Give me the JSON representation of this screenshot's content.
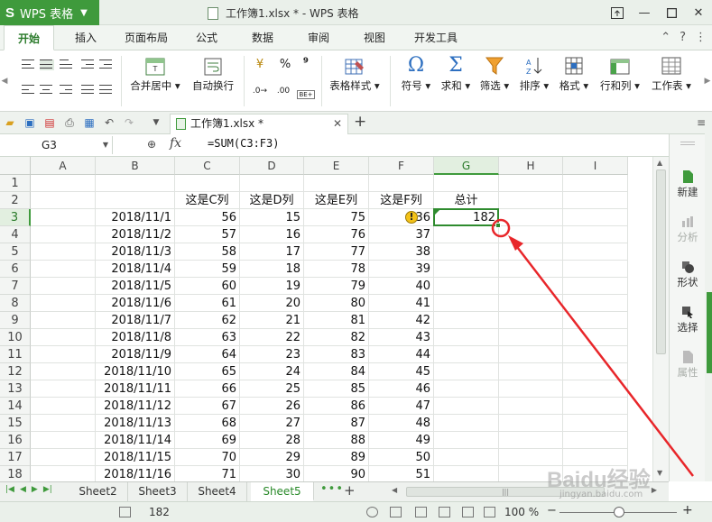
{
  "titlebar": {
    "app_name": "WPS 表格",
    "window_title": "工作簿1.xlsx * - WPS 表格"
  },
  "menu": {
    "tabs": [
      "开始",
      "插入",
      "页面布局",
      "公式",
      "数据",
      "审阅",
      "视图",
      "开发工具"
    ],
    "active_tab": "开始"
  },
  "ribbon": {
    "merge_center": "合并居中",
    "auto_wrap": "自动换行",
    "percent": "%",
    "comma": "⁹",
    "table_style": "表格样式",
    "symbol": "符号",
    "sum": "求和",
    "filter": "筛选",
    "sort": "排序",
    "format": "格式",
    "row_col": "行和列",
    "worksheet": "工作表"
  },
  "doc_tab": {
    "title": "工作簿1.xlsx *"
  },
  "formula_bar": {
    "cell_ref": "G3",
    "fx": "fx",
    "formula": "=SUM(C3:F3)"
  },
  "grid": {
    "columns": [
      "A",
      "B",
      "C",
      "D",
      "E",
      "F",
      "G",
      "H",
      "I"
    ],
    "row_numbers": [
      "1",
      "2",
      "3",
      "4",
      "5",
      "6",
      "7",
      "8",
      "9",
      "10",
      "11",
      "12",
      "13",
      "14",
      "15",
      "16",
      "17",
      "18"
    ],
    "headers_row2": {
      "C": "这是C列",
      "D": "这是D列",
      "E": "这是E列",
      "F": "这是F列",
      "G": "总计"
    },
    "rows": [
      {
        "date": "2018/11/1",
        "c": "56",
        "d": "15",
        "e": "75",
        "f": "36",
        "g": "182"
      },
      {
        "date": "2018/11/2",
        "c": "57",
        "d": "16",
        "e": "76",
        "f": "37",
        "g": ""
      },
      {
        "date": "2018/11/3",
        "c": "58",
        "d": "17",
        "e": "77",
        "f": "38",
        "g": ""
      },
      {
        "date": "2018/11/4",
        "c": "59",
        "d": "18",
        "e": "78",
        "f": "39",
        "g": ""
      },
      {
        "date": "2018/11/5",
        "c": "60",
        "d": "19",
        "e": "79",
        "f": "40",
        "g": ""
      },
      {
        "date": "2018/11/6",
        "c": "61",
        "d": "20",
        "e": "80",
        "f": "41",
        "g": ""
      },
      {
        "date": "2018/11/7",
        "c": "62",
        "d": "21",
        "e": "81",
        "f": "42",
        "g": ""
      },
      {
        "date": "2018/11/8",
        "c": "63",
        "d": "22",
        "e": "82",
        "f": "43",
        "g": ""
      },
      {
        "date": "2018/11/9",
        "c": "64",
        "d": "23",
        "e": "83",
        "f": "44",
        "g": ""
      },
      {
        "date": "2018/11/10",
        "c": "65",
        "d": "24",
        "e": "84",
        "f": "45",
        "g": ""
      },
      {
        "date": "2018/11/11",
        "c": "66",
        "d": "25",
        "e": "85",
        "f": "46",
        "g": ""
      },
      {
        "date": "2018/11/12",
        "c": "67",
        "d": "26",
        "e": "86",
        "f": "47",
        "g": ""
      },
      {
        "date": "2018/11/13",
        "c": "68",
        "d": "27",
        "e": "87",
        "f": "48",
        "g": ""
      },
      {
        "date": "2018/11/14",
        "c": "69",
        "d": "28",
        "e": "88",
        "f": "49",
        "g": ""
      },
      {
        "date": "2018/11/15",
        "c": "70",
        "d": "29",
        "e": "89",
        "f": "50",
        "g": ""
      },
      {
        "date": "2018/11/16",
        "c": "71",
        "d": "30",
        "e": "90",
        "f": "51",
        "g": ""
      }
    ],
    "selected_cell": "G3"
  },
  "side_panel": {
    "items": [
      {
        "label": "新建",
        "icon": "new-doc-icon",
        "enabled": true
      },
      {
        "label": "分析",
        "icon": "analyze-icon",
        "enabled": false
      },
      {
        "label": "形状",
        "icon": "shape-icon",
        "enabled": true
      },
      {
        "label": "选择",
        "icon": "select-icon",
        "enabled": true
      },
      {
        "label": "属性",
        "icon": "property-icon",
        "enabled": false
      }
    ]
  },
  "sheets": {
    "tabs": [
      "Sheet2",
      "Sheet3",
      "Sheet4",
      "Sheet5"
    ],
    "active": "Sheet5",
    "more": "•••",
    "add": "+"
  },
  "status": {
    "sum_value": "182",
    "zoom": "100 %"
  },
  "watermark": {
    "brand": "Baidu经验",
    "url": "jingyan.baidu.com"
  },
  "colors": {
    "accent": "#3f9a3c",
    "selection": "#2e8b2e",
    "annotation": "#e8262a",
    "warning": "#f3c219"
  }
}
